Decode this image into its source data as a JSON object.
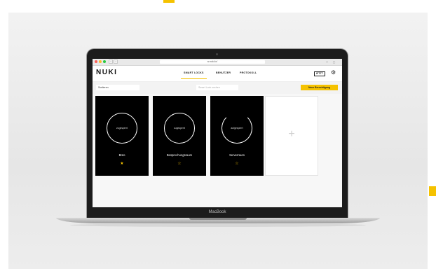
{
  "browser": {
    "url": "w.nuki.io/",
    "nav_back": "‹",
    "nav_forward": "›",
    "share_icon": "share-icon",
    "tabs_icon": "tabs-icon"
  },
  "app": {
    "logo": "NUKI",
    "tabs": [
      {
        "label": "SMART LOCKS",
        "active": true
      },
      {
        "label": "BENUTZER",
        "active": false
      },
      {
        "label": "PROTOKOLL",
        "active": false
      }
    ],
    "ifttt": "IFTTT",
    "settings_icon": "gear-icon"
  },
  "toolbar": {
    "sort_value": "Sortieren",
    "search_placeholder": "Smart Lock suchen",
    "cta_label": "Neue Berechtigung"
  },
  "locks": [
    {
      "state": "zugesperrt",
      "name": "Büro",
      "star": "★",
      "ring": "closed"
    },
    {
      "state": "zugesperrt",
      "name": "Besprechungsraum",
      "star": "☆",
      "ring": "closed"
    },
    {
      "state": "aufgesperrt",
      "name": "Serverraum",
      "star": "☆",
      "ring": "open"
    }
  ],
  "add_card": {
    "plus": "+"
  },
  "device": {
    "label": "MacBook"
  },
  "colors": {
    "accent": "#f5c200",
    "card": "#000000"
  }
}
